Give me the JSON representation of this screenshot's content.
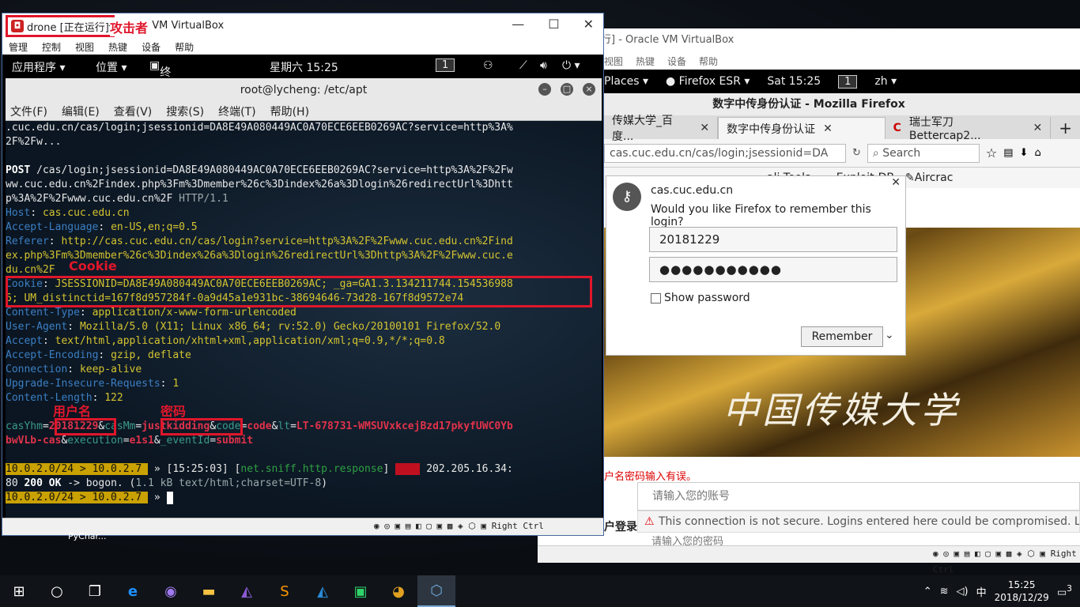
{
  "vm1": {
    "title_name": "drone [正在运行]",
    "title_rest": "- Oracle VM VirtualBox",
    "attacker_label": "攻击者",
    "menu": [
      "管理",
      "控制",
      "视图",
      "热键",
      "设备",
      "帮助"
    ],
    "gnome": {
      "apps": "应用程序 ▾",
      "places": "位置 ▾",
      "terminal": "终端 ▾",
      "clock": "星期六 15:25",
      "workspace": "1"
    },
    "terminal": {
      "title": "root@lycheng: /etc/apt",
      "menu": [
        "文件(F)",
        "编辑(E)",
        "查看(V)",
        "搜索(S)",
        "终端(T)",
        "帮助(H)"
      ],
      "lines": {
        "l1": ".cuc.edu.cn/cas/login;jsessionid=DA8E49A080449AC0A70ECE6EEB0269AC?service=http%3A%",
        "l2": "2F%2Fw...",
        "post_method": "POST",
        "post_rest": " /cas/login;jsessionid=DA8E49A080449AC0A70ECE6EEB0269AC?service=http%3A%2F%2Fw",
        "post2": "ww.cuc.edu.cn%2Findex.php%3Fm%3Dmember%26c%3Dindex%26a%3Dlogin%26redirectUrl%3Dhtt",
        "post3a": "p%3A%2F%2Fwww.cuc.edu.cn%2F ",
        "post3b": "HTTP/1.1",
        "host_k": "Host",
        "host_v": "cas.cuc.edu.cn",
        "lang_k": "Accept-Language",
        "lang_v": "en-US,en;q=0.5",
        "ref_k": "Referer",
        "ref_v1": "http://cas.cuc.edu.cn/cas/login?service=http%3A%2F%2Fwww.cuc.edu.cn%2Find",
        "ref_v2": "ex.php%3Fm%3Dmember%26c%3Dindex%26a%3Dlogin%26redirectUrl%3Dhttp%3A%2F%2Fwww.cuc.e",
        "ref_v3": "du.cn%2F",
        "cookie_k": "Cookie",
        "cookie_v1": "JSESSIONID=DA8E49A080449AC0A70ECE6EEB0269AC; _ga=GA1.3.134211744.154536988",
        "cookie_v2": "6; UM_distinctid=167f8d957284f-0a9d45a1e931bc-38694646-73d28-167f8d9572e74",
        "ct_k": "Content-Type",
        "ct_v": "application/x-www-form-urlencoded",
        "ua_k": "User-Agent",
        "ua_v": "Mozilla/5.0 (X11; Linux x86_64; rv:52.0) Gecko/20100101 Firefox/52.0",
        "acc_k": "Accept",
        "acc_v": "text/html,application/xhtml+xml,application/xml;q=0.9,*/*;q=0.8",
        "enc_k": "Accept-Encoding",
        "enc_v": "gzip, deflate",
        "conn_k": "Connection",
        "conn_v": "keep-alive",
        "uir_k": "Upgrade-Insecure-Requests",
        "uir_v": "1",
        "cl_k": "Content-Length",
        "cl_v": "122",
        "p_user_k": "casYhm",
        "p_user_v": "20181229",
        "p_pass_k": "casMm",
        "p_pass_v": "justkidding",
        "p_code_k": "code",
        "p_code_v": "code",
        "p_lt_k": "lt",
        "p_lt_v": "LT-678731-WMSUVxkcejBzd17pkyfUWC0Yb",
        "p2_a": "bwVLb-cas",
        "p2_exec_k": "execution",
        "p2_exec_v": "e1s1",
        "p2_ev_k": "_eventId",
        "p2_ev_v": "submit",
        "resp_prompt": "10.0.2.0/24 > 10.0.2.7 ",
        "resp_time": " » [15:25:03] [",
        "resp_mod": "net.sniff.http.response",
        "resp_end": "] ",
        "resp_badge": "http",
        "resp_ip": " 202.205.16.34:",
        "resp2a": "80 ",
        "resp2b": "200 OK",
        "resp2c": " -> bogon. (",
        "resp2d": "1.1 kB text/html;charset=UTF-8",
        "resp2e": ")",
        "last_prompt": "10.0.2.0/24 > 10.0.2.7 ",
        "last_arrow": " » "
      }
    },
    "annotations": {
      "cookie": "Cookie",
      "username": "用户名",
      "password": "密码"
    },
    "status_right": "Right Ctrl"
  },
  "vm2": {
    "title": "行] - Oracle VM VirtualBox",
    "menu": [
      "视图",
      "热键",
      "设备",
      "帮助"
    ],
    "gnome": {
      "places": "Places ▾",
      "firefox": "Firefox ESR ▾",
      "clock": "Sat 15:25",
      "workspace": "1",
      "lang": "zh ▾"
    },
    "firefox_title": "数字中传身份认证 - Mozilla Firefox",
    "tabs": [
      "传媒大学_百度...",
      "数字中传身份认证",
      "瑞士军刀 Bettercap2..."
    ],
    "url": "cas.cuc.edu.cn/cas/login;jsessionid=DA",
    "search_placeholder": "Search",
    "bookmarks": [
      "ali Tools",
      "Exploit-DB",
      "Aircrac"
    ],
    "popup": {
      "site": "cas.cuc.edu.cn",
      "question": "Would you like Firefox to remember this login?",
      "username": "20181229",
      "password": "●●●●●●●●●●●",
      "show_password": "Show password",
      "remember": "Remember"
    },
    "banner_text": "中国传媒大学",
    "login_title": "户登录",
    "error_text": "户名密码输入有误。",
    "account_placeholder": "请输入您的账号",
    "insecure_notice": "This connection is not secure. Logins entered here could be compromised. Learn Mo",
    "password_placeholder": "请输入您的密码",
    "status_right": "Right Ctrl"
  },
  "desktop": {
    "pycharm_label": "PyChar..."
  },
  "taskbar": {
    "time": "15:25",
    "date": "2018/12/29",
    "ime": "中",
    "notifications": "3",
    "icons": [
      "windows-start-icon",
      "cortana-icon",
      "task-view-icon",
      "edge-icon",
      "app-icon",
      "file-explorer-icon",
      "visual-studio-icon",
      "sublime-icon",
      "vscode-icon",
      "pycharm-icon",
      "chrome-icon",
      "virtualbox-icon"
    ]
  }
}
